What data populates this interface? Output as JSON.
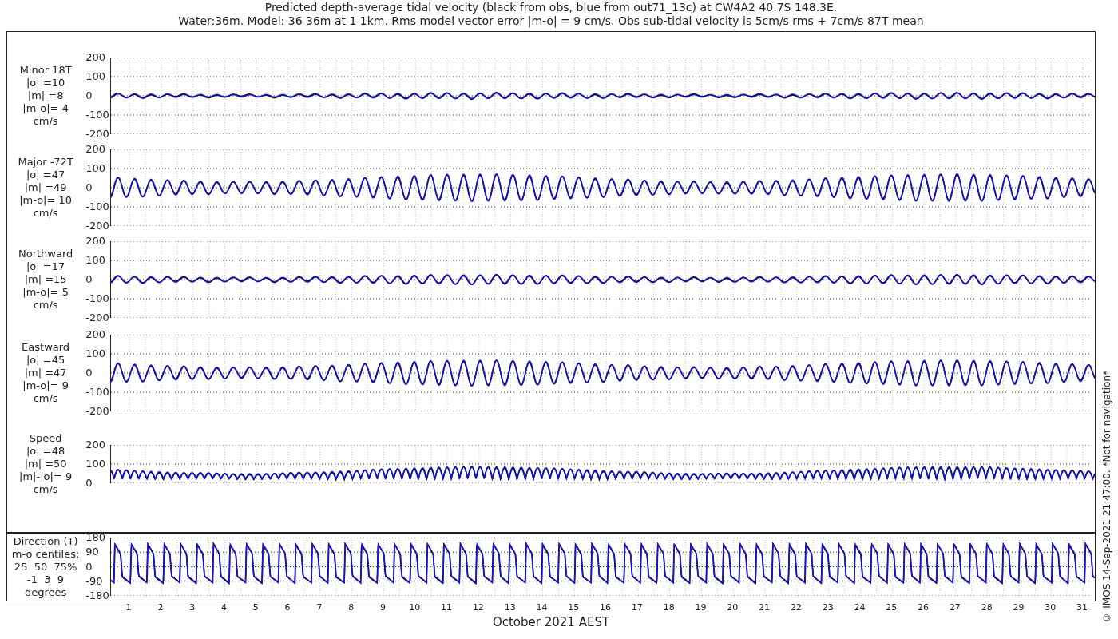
{
  "title": [
    "Predicted depth-average tidal velocity (black from obs, blue from out71_13c) at CW4A2 40.7S 148.3E.",
    "Water:36m. Model: 36 36m at 1 1km. Rms model vector error |m-o| = 9 cm/s. Obs sub-tidal velocity is 5cm/s rms + 7cm/s 87T mean"
  ],
  "panels": [
    {
      "kind": "velocity",
      "label": [
        "Minor 18T",
        "|o| =10",
        "|m| =8",
        "|m-o|= 4",
        "cm/s"
      ],
      "yticks": [
        "200",
        "100",
        "0",
        "-100",
        "-200"
      ]
    },
    {
      "kind": "velocity",
      "label": [
        "Major -72T",
        "|o| =47",
        "|m| =49",
        "|m-o|= 10",
        "cm/s"
      ],
      "yticks": [
        "200",
        "100",
        "0",
        "-100",
        "-200"
      ]
    },
    {
      "kind": "velocity",
      "label": [
        "Northward",
        "|o| =17",
        "|m| =15",
        "|m-o|= 5",
        "cm/s"
      ],
      "yticks": [
        "200",
        "100",
        "0",
        "-100",
        "-200"
      ]
    },
    {
      "kind": "velocity",
      "label": [
        "Eastward",
        "|o| =45",
        "|m| =47",
        "|m-o|= 9",
        "cm/s"
      ],
      "yticks": [
        "200",
        "100",
        "0",
        "-100",
        "-200"
      ]
    },
    {
      "kind": "speed",
      "label": [
        "Speed",
        "|o| =48",
        "|m| =50",
        "|m|-|o|= 9",
        "cm/s"
      ],
      "yticks": [
        "200",
        "100",
        "0"
      ]
    },
    {
      "kind": "direction",
      "label": [
        "Direction (T)",
        "m-o centiles:",
        "25  50  75%",
        "-1  3  9",
        "degrees"
      ],
      "yticks": [
        "180",
        "90",
        "0",
        "-90",
        "-180"
      ]
    }
  ],
  "xticks": [
    "1",
    "2",
    "3",
    "4",
    "5",
    "6",
    "7",
    "8",
    "9",
    "10",
    "11",
    "12",
    "13",
    "14",
    "15",
    "16",
    "17",
    "18",
    "19",
    "20",
    "21",
    "22",
    "23",
    "24",
    "25",
    "26",
    "27",
    "28",
    "29",
    "30",
    "31"
  ],
  "xlabel": "October 2021 AEST",
  "footer": "© IMOS 14-Sep-2021 21:47:00. *Not for navigation*"
}
